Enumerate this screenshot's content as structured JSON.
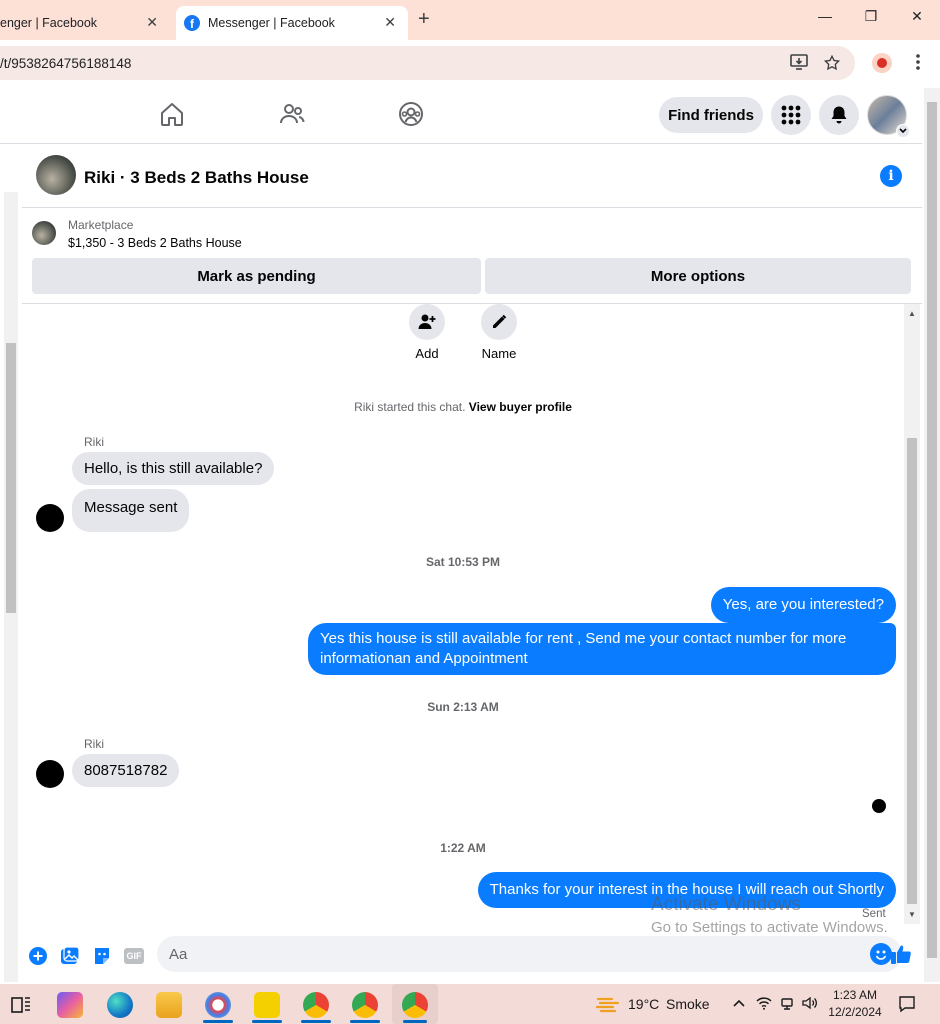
{
  "browser": {
    "tabs": [
      {
        "title": "enger | Facebook",
        "active": false
      },
      {
        "title": "Messenger | Facebook",
        "active": true
      }
    ],
    "new_tab": "+",
    "url": "/t/9538264756188148",
    "window_controls": {
      "minimize": "—",
      "restore": "❐",
      "close": "✕"
    },
    "tab_close": "✕",
    "fb_favicon": "f",
    "icons": [
      "install-app-icon",
      "star-icon",
      "profile-icon",
      "kebab-menu-icon"
    ]
  },
  "fbnav": {
    "icons": [
      "home-icon",
      "friends-icon",
      "groups-icon"
    ],
    "find_friends": "Find friends",
    "right_icons": [
      "menu-grid-icon",
      "notifications-bell-icon",
      "account-avatar"
    ]
  },
  "chat": {
    "title": "Riki · 3 Beds 2 Baths House",
    "info_glyph": "i",
    "marketplace": {
      "label": "Marketplace",
      "listing": "$1,350 - 3 Beds 2 Baths House",
      "mark_pending": "Mark as pending",
      "more_options": "More options"
    },
    "actions": [
      {
        "label": "Add",
        "icon": "add-person-icon"
      },
      {
        "label": "Name",
        "icon": "pencil-icon"
      }
    ],
    "started": "Riki started this chat.",
    "view_profile": "View buyer profile",
    "messages": [
      {
        "sender": "Riki",
        "text": "Hello, is this still available?",
        "dir": "in"
      },
      {
        "text": "Message sent",
        "dir": "in"
      },
      {
        "timestamp": "Sat 10:53 PM"
      },
      {
        "text": "Yes, are you interested?",
        "dir": "out"
      },
      {
        "text": "Yes this house is still available for rent , Send me your contact number for more informationan and Appointment",
        "dir": "out"
      },
      {
        "timestamp": "Sun 2:13 AM"
      },
      {
        "sender": "Riki",
        "text": "8087518782",
        "dir": "in"
      },
      {
        "timestamp": "1:22 AM"
      },
      {
        "text": "Thanks for your interest in the house I will reach out Shortly",
        "dir": "out"
      }
    ],
    "status": "Sent",
    "composer": {
      "placeholder": "Aa",
      "icons": [
        "plus-icon",
        "photo-icon",
        "sticker-icon",
        "gif-icon",
        "emoji-icon",
        "like-thumb-icon"
      ],
      "gif": "GIF"
    }
  },
  "watermark": {
    "line1": "Activate Windows",
    "line2": "Go to Settings to activate Windows."
  },
  "taskbar": {
    "apps": [
      "task-view-icon",
      "copilot-icon",
      "edge-icon",
      "file-explorer-icon",
      "paint-icon",
      "sticky-notes-icon",
      "chrome-a-icon",
      "chrome-profile-icon",
      "chrome-active-icon"
    ],
    "weather_temp": "19°C",
    "weather_desc": "Smoke",
    "time": "1:23 AM",
    "date": "12/2/2024"
  },
  "colors": {
    "messenger_blue": "#0a7cff",
    "facebook_blue": "#1877f2",
    "bubble_gray": "#e4e6eb",
    "tab_bar": "#fde1d7"
  }
}
